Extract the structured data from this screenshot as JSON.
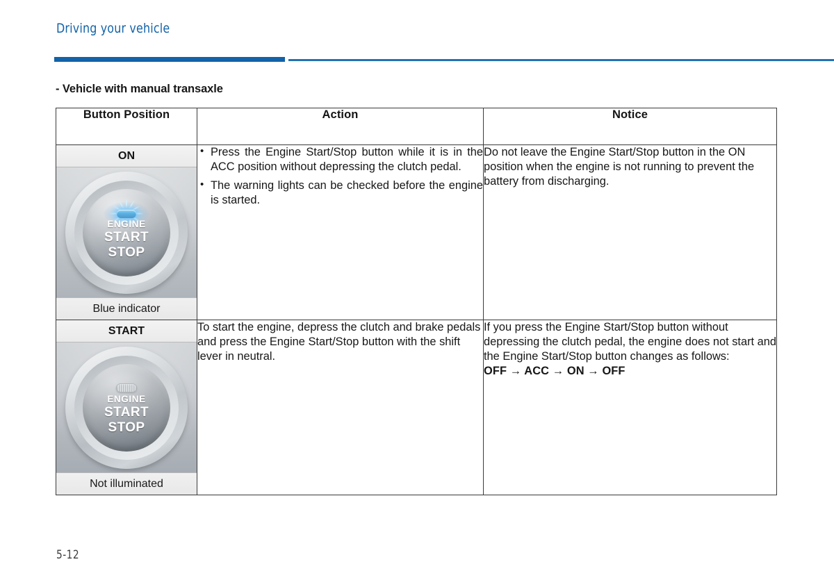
{
  "header": {
    "chapter_title": "Driving your vehicle",
    "accent_color": "#1263a8"
  },
  "section": {
    "subtitle": "- Vehicle with manual transaxle"
  },
  "table": {
    "columns": [
      "Button Position",
      "Action",
      "Notice"
    ],
    "rows": [
      {
        "position_label": "ON",
        "position_caption": "Blue indicator",
        "button_text": {
          "line1": "ENGINE",
          "line2": "START",
          "line3": "STOP"
        },
        "indicator_state": "lit-blue",
        "action_bullets": [
          "Press the Engine Start/Stop button while it is in the ACC position without depressing the clutch pedal.",
          "The warning lights can be checked before the engine is started."
        ],
        "notice_text": "Do not leave the Engine Start/Stop button in the ON position when the engine is not running to prevent the battery from discharging.",
        "notice_sequence": ""
      },
      {
        "position_label": "START",
        "position_caption": "Not illuminated",
        "button_text": {
          "line1": "ENGINE",
          "line2": "START",
          "line3": "STOP"
        },
        "indicator_state": "unlit",
        "action_bullets": [],
        "action_text": "To start the engine, depress the clutch and brake pedals and press the Engine Start/Stop button with the shift lever in neutral.",
        "notice_text": "If you press the Engine Start/Stop button without depressing the clutch pedal, the engine does not start and the Engine Start/Stop button changes as follows:",
        "notice_sequence": "OFF → ACC → ON → OFF"
      }
    ]
  },
  "footer": {
    "page_number": "5-12"
  }
}
